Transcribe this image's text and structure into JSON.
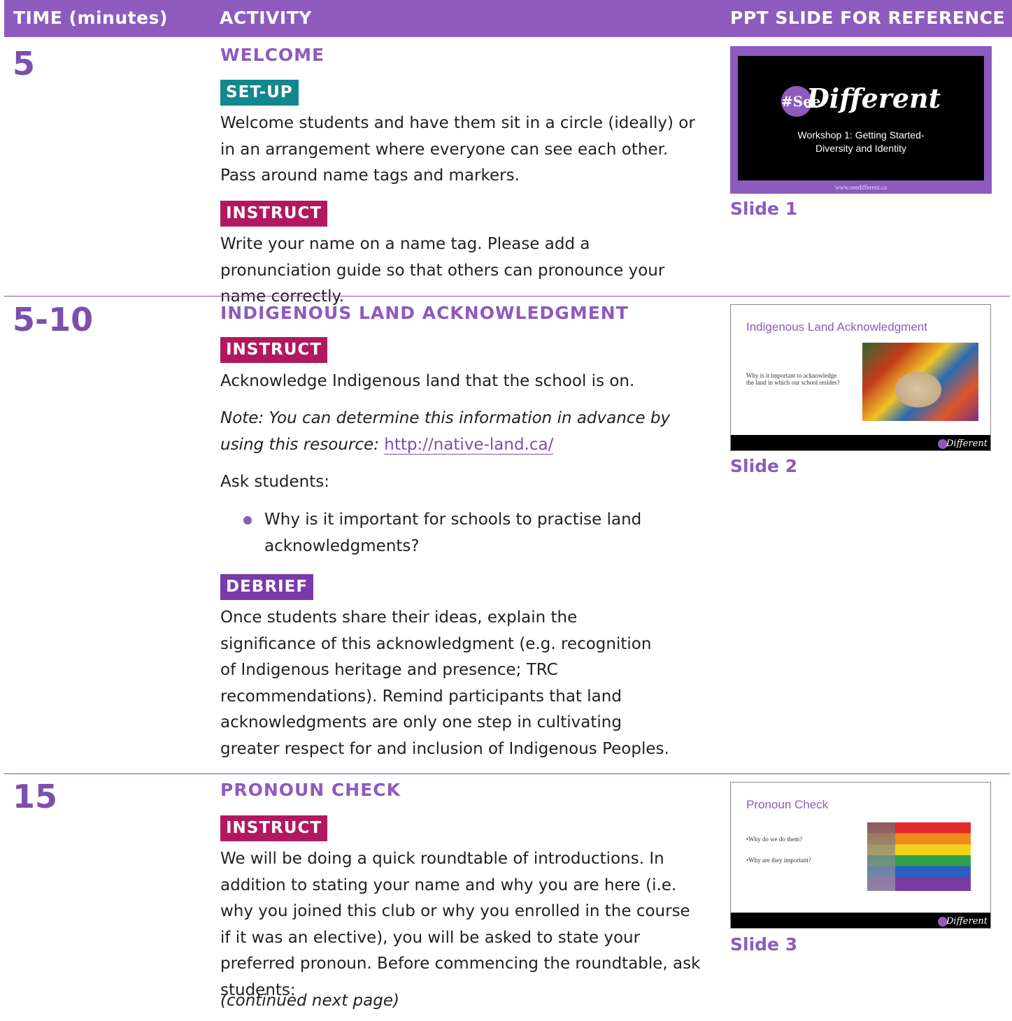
{
  "header": {
    "col_time": "TIME (minutes)",
    "col_activity": "ACTIVITY",
    "col_slide": "PPT SLIDE FOR REFERENCE"
  },
  "rows": [
    {
      "time": "5",
      "title": "WELCOME",
      "sections": [
        {
          "tag": "SET-UP",
          "text": "Welcome students and have them sit in a circle (ideally) or in an arrangement where everyone can see each other. Pass around name tags and markers."
        },
        {
          "tag": "INSTRUCT",
          "text": "Write your name on a name tag. Please add a pronunciation guide so that others can pronounce your name correctly."
        }
      ],
      "slide": {
        "label": "Slide 1",
        "logo_mark": "#See",
        "logo_word": "Different",
        "subtitle_1": "Workshop 1: Getting Started-",
        "subtitle_2": "Diversity and Identity",
        "url": "www.seedifferent.ca"
      }
    },
    {
      "time": "5-10",
      "title": "INDIGENOUS LAND ACKNOWLEDGMENT",
      "instruct_tag": "INSTRUCT",
      "instruct_text": "Acknowledge Indigenous land that the school is on.",
      "note_text": "Note: You can determine this information in advance by using this resource:",
      "note_link": "http://native-land.ca/",
      "ask_text": "Ask students:",
      "bullet_text": "Why is it important for schools to practise land acknowledgments?",
      "debrief_tag": "DEBRIEF",
      "debrief_text": "Once students share their ideas, explain the significance of this acknowledgment (e.g. recognition of Indigenous heritage and presence; TRC recommendations). Remind participants that land acknowledgments are only one step in cultivating greater respect for and inclusion of Indigenous Peoples.",
      "slide": {
        "label": "Slide 2",
        "title": "Indigenous Land Acknowledgment",
        "body_1": "Why is it important to acknowledge",
        "body_2": "the land in which our school resides?",
        "foot_logo": "Different"
      }
    },
    {
      "time": "15",
      "title": "PRONOUN CHECK",
      "instruct_tag": "INSTRUCT",
      "instruct_text": "We will be doing a quick roundtable of introductions. In addition to stating your name and why you are here (i.e. why you joined this club or why you enrolled in the course if it was an elective), you will be asked to state your preferred pronoun. Before commencing the roundtable, ask students:",
      "continued": "(continued next page)",
      "slide": {
        "label": "Slide 3",
        "title": "Pronoun Check",
        "bullet_1": "•Why do we do them?",
        "bullet_2": "•Why are they important?",
        "foot_logo": "Different"
      }
    }
  ]
}
